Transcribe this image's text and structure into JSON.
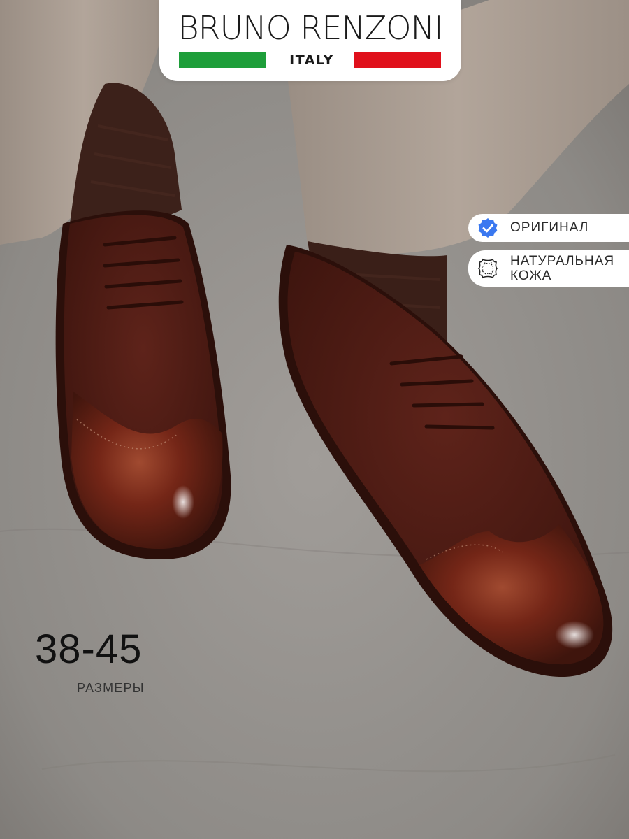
{
  "brand": {
    "name": "BRUNO RENZONI",
    "country": "ITALY",
    "flag_green": "#1e9e3a",
    "flag_red": "#e0101b"
  },
  "badges": [
    {
      "label": "ОРИГИНАЛ",
      "icon": "verified-check-icon",
      "color": "#3a78f0"
    },
    {
      "label_line1": "НАТУРАЛЬНАЯ",
      "label_line2": "КОЖА",
      "icon": "leather-hide-icon"
    }
  ],
  "sizes": {
    "range": "38-45",
    "label": "РАЗМЕРЫ"
  },
  "colors": {
    "floor": "#8f8c89",
    "trousers": "#a79a8f",
    "shoe_leather": "#5a1f15",
    "shoe_toe": "#7a2a1a",
    "socks": "#3c211a"
  }
}
